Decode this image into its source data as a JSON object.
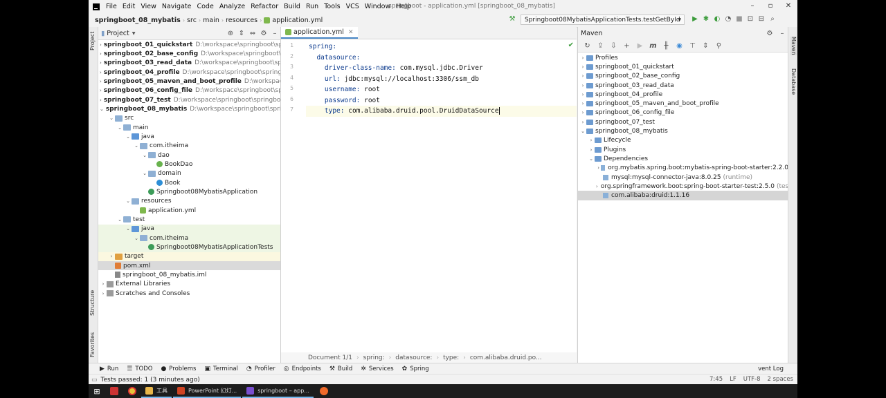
{
  "window": {
    "title": "springboot - application.yml [springboot_08_mybatis]",
    "menu": [
      "File",
      "Edit",
      "View",
      "Navigate",
      "Code",
      "Analyze",
      "Refactor",
      "Build",
      "Run",
      "Tools",
      "VCS",
      "Window",
      "Help"
    ]
  },
  "nav": {
    "crumbs": [
      "springboot_08_mybatis",
      "src",
      "main",
      "resources",
      "application.yml"
    ],
    "run_config": "Springboot08MybatisApplicationTests.testGetById"
  },
  "stripes": {
    "left": [
      "Project",
      "Structure",
      "Favorites"
    ],
    "right": [
      "Maven",
      "Database"
    ]
  },
  "project": {
    "title": "Project",
    "tree": [
      {
        "label": "springboot_01_quickstart",
        "path": "D:\\workspace\\springboot\\spr",
        "depth": 0,
        "arrow": "›",
        "icon": "folder-mod",
        "module": true
      },
      {
        "label": "springboot_02_base_config",
        "path": "D:\\workspace\\springboot\\s",
        "depth": 0,
        "arrow": "›",
        "icon": "folder-mod",
        "module": true
      },
      {
        "label": "springboot_03_read_data",
        "path": "D:\\workspace\\springboot\\spr",
        "depth": 0,
        "arrow": "›",
        "icon": "folder-mod",
        "module": true
      },
      {
        "label": "springboot_04_profile",
        "path": "D:\\workspace\\springboot\\springl",
        "depth": 0,
        "arrow": "›",
        "icon": "folder-mod",
        "module": true
      },
      {
        "label": "springboot_05_maven_and_boot_profile",
        "path": "D:\\workspace",
        "depth": 0,
        "arrow": "›",
        "icon": "folder-mod",
        "module": true
      },
      {
        "label": "springboot_06_config_file",
        "path": "D:\\workspace\\springboot\\spr",
        "depth": 0,
        "arrow": "›",
        "icon": "folder-mod",
        "module": true
      },
      {
        "label": "springboot_07_test",
        "path": "D:\\workspace\\springboot\\springboo",
        "depth": 0,
        "arrow": "›",
        "icon": "folder-mod",
        "module": true
      },
      {
        "label": "springboot_08_mybatis",
        "path": "D:\\workspace\\springboot\\sprin",
        "depth": 0,
        "arrow": "⌄",
        "icon": "folder-mod",
        "module": true
      },
      {
        "label": "src",
        "path": "",
        "depth": 1,
        "arrow": "⌄",
        "icon": "folder"
      },
      {
        "label": "main",
        "path": "",
        "depth": 2,
        "arrow": "⌄",
        "icon": "folder"
      },
      {
        "label": "java",
        "path": "",
        "depth": 3,
        "arrow": "⌄",
        "icon": "folder-blue"
      },
      {
        "label": "com.itheima",
        "path": "",
        "depth": 4,
        "arrow": "⌄",
        "icon": "folder"
      },
      {
        "label": "dao",
        "path": "",
        "depth": 5,
        "arrow": "⌄",
        "icon": "folder"
      },
      {
        "label": "BookDao",
        "path": "",
        "depth": 6,
        "arrow": "",
        "icon": "ico-iface"
      },
      {
        "label": "domain",
        "path": "",
        "depth": 5,
        "arrow": "⌄",
        "icon": "folder"
      },
      {
        "label": "Book",
        "path": "",
        "depth": 6,
        "arrow": "",
        "icon": "ico-class"
      },
      {
        "label": "Springboot08MybatisApplication",
        "path": "",
        "depth": 5,
        "arrow": "",
        "icon": "ico-java"
      },
      {
        "label": "resources",
        "path": "",
        "depth": 3,
        "arrow": "⌄",
        "icon": "folder"
      },
      {
        "label": "application.yml",
        "path": "",
        "depth": 4,
        "arrow": "",
        "icon": "ico-yaml"
      },
      {
        "label": "test",
        "path": "",
        "depth": 2,
        "arrow": "⌄",
        "icon": "folder"
      },
      {
        "label": "java",
        "path": "",
        "depth": 3,
        "arrow": "⌄",
        "icon": "folder-blue",
        "hl": "green"
      },
      {
        "label": "com.itheima",
        "path": "",
        "depth": 4,
        "arrow": "⌄",
        "icon": "folder",
        "hl": "green"
      },
      {
        "label": "Springboot08MybatisApplicationTests",
        "path": "",
        "depth": 5,
        "arrow": "",
        "icon": "ico-java",
        "hl": "green"
      },
      {
        "label": "target",
        "path": "",
        "depth": 1,
        "arrow": "›",
        "icon": "folder-orange",
        "hl": "yellow"
      },
      {
        "label": "pom.xml",
        "path": "",
        "depth": 1,
        "arrow": "",
        "icon": "ico-xml",
        "hl": "sel"
      },
      {
        "label": "springboot_08_mybatis.iml",
        "path": "",
        "depth": 1,
        "arrow": "",
        "icon": "ico-iml"
      },
      {
        "label": "External Libraries",
        "path": "",
        "depth": 0,
        "arrow": "›",
        "icon": "ico-lib"
      },
      {
        "label": "Scratches and Consoles",
        "path": "",
        "depth": 0,
        "arrow": "›",
        "icon": "ico-lib"
      }
    ]
  },
  "editor": {
    "tab": "application.yml",
    "lines": [
      {
        "n": "1",
        "indent": "",
        "key": "spring:",
        "value": ""
      },
      {
        "n": "2",
        "indent": "  ",
        "key": "datasource:",
        "value": ""
      },
      {
        "n": "3",
        "indent": "    ",
        "key": "driver-class-name:",
        "value": " com.mysql.jdbc.Driver"
      },
      {
        "n": "4",
        "indent": "    ",
        "key": "url:",
        "value": " jdbc:mysql://localhost:3306/ssm_db"
      },
      {
        "n": "5",
        "indent": "    ",
        "key": "username:",
        "value": " root"
      },
      {
        "n": "6",
        "indent": "    ",
        "key": "password:",
        "value": " root"
      },
      {
        "n": "7",
        "indent": "    ",
        "key": "type:",
        "value": " com.alibaba.druid.pool.DruidDataSource"
      }
    ],
    "breadcrumb": [
      "Document 1/1",
      "spring:",
      "datasource:",
      "type:",
      "com.alibaba.druid.po..."
    ]
  },
  "maven": {
    "title": "Maven",
    "tree": [
      {
        "label": "Profiles",
        "depth": 0,
        "arrow": "›"
      },
      {
        "label": "springboot_01_quickstart",
        "depth": 0,
        "arrow": "›"
      },
      {
        "label": "springboot_02_base_config",
        "depth": 0,
        "arrow": "›"
      },
      {
        "label": "springboot_03_read_data",
        "depth": 0,
        "arrow": "›"
      },
      {
        "label": "springboot_04_profile",
        "depth": 0,
        "arrow": "›"
      },
      {
        "label": "springboot_05_maven_and_boot_profile",
        "depth": 0,
        "arrow": "›"
      },
      {
        "label": "springboot_06_config_file",
        "depth": 0,
        "arrow": "›"
      },
      {
        "label": "springboot_07_test",
        "depth": 0,
        "arrow": "›"
      },
      {
        "label": "springboot_08_mybatis",
        "depth": 0,
        "arrow": "⌄"
      },
      {
        "label": "Lifecycle",
        "depth": 1,
        "arrow": "›"
      },
      {
        "label": "Plugins",
        "depth": 1,
        "arrow": "›"
      },
      {
        "label": "Dependencies",
        "depth": 1,
        "arrow": "⌄"
      },
      {
        "label": "org.mybatis.spring.boot:mybatis-spring-boot-starter:2.2.0",
        "depth": 2,
        "arrow": "›",
        "dep": true
      },
      {
        "label": "mysql:mysql-connector-java:8.0.25",
        "suffix": "(runtime)",
        "depth": 2,
        "arrow": "",
        "dep": true
      },
      {
        "label": "org.springframework.boot:spring-boot-starter-test:2.5.0",
        "suffix": "(test)",
        "depth": 2,
        "arrow": "›",
        "dep": true
      },
      {
        "label": "com.alibaba:druid:1.1.16",
        "depth": 2,
        "arrow": "",
        "dep": true,
        "sel": true
      }
    ]
  },
  "toolwindows": [
    {
      "icon": "▶",
      "label": "Run"
    },
    {
      "icon": "☰",
      "label": "TODO"
    },
    {
      "icon": "●",
      "label": "Problems"
    },
    {
      "icon": "▣",
      "label": "Terminal"
    },
    {
      "icon": "◔",
      "label": "Profiler"
    },
    {
      "icon": "◎",
      "label": "Endpoints"
    },
    {
      "icon": "⚒",
      "label": "Build"
    },
    {
      "icon": "✲",
      "label": "Services"
    },
    {
      "icon": "✿",
      "label": "Spring"
    }
  ],
  "event_log": "vent Log",
  "status": {
    "message": "Tests passed: 1 (3 minutes ago)",
    "position": "7:45",
    "encoding": "UTF-8",
    "indent": "2 spaces"
  },
  "taskbar": {
    "apps": [
      {
        "label": "工具",
        "color": "#e8b64a"
      },
      {
        "label": "PowerPoint 幻灯...",
        "color": "#d04423"
      },
      {
        "label": "springboot – app...",
        "color": "#7a4fd0"
      }
    ]
  }
}
